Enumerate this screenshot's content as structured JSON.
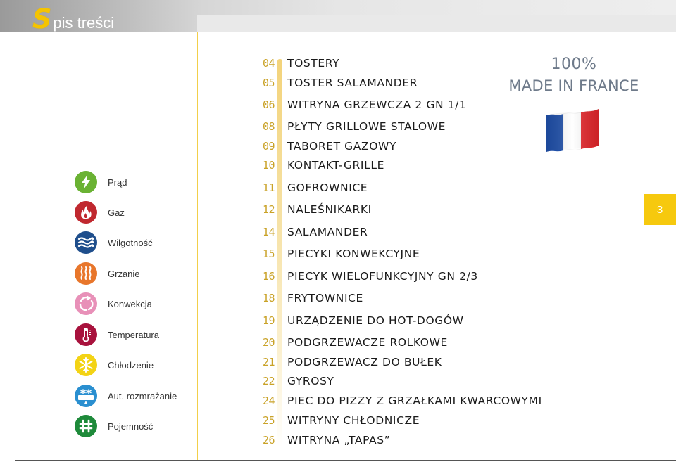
{
  "header": {
    "title_initial": "S",
    "title_rest": "pis treści"
  },
  "legend": [
    {
      "label": "Prąd",
      "icon": "lightning-icon",
      "color": "#6ab233"
    },
    {
      "label": "Gaz",
      "icon": "gas-flame-icon",
      "color": "#c0282f"
    },
    {
      "label": "Wilgotność",
      "icon": "humidity-waves-icon",
      "color": "#1f4e8c"
    },
    {
      "label": "Grzanie",
      "icon": "heating-icon",
      "color": "#e8762b"
    },
    {
      "label": "Konwekcja",
      "icon": "convection-icon",
      "color": "#e890b8"
    },
    {
      "label": "Temperatura",
      "icon": "thermometer-icon",
      "color": "#a8123d"
    },
    {
      "label": "Chłodzenie",
      "icon": "snowflake-icon",
      "color": "#f3d315"
    },
    {
      "label": "Aut. rozmrażanie",
      "icon": "auto-defrost-icon",
      "color": "#2a8fd0"
    },
    {
      "label": "Pojemność",
      "icon": "capacity-grid-icon",
      "color": "#1e8a3a"
    }
  ],
  "toc": [
    {
      "page": "04",
      "title": "TOSTERY"
    },
    {
      "page": "05",
      "title": "TOSTER SALAMANDER"
    },
    {
      "page": "06",
      "title": "WITRYNA GRZEWCZA 2 GN 1/1"
    },
    {
      "page": "08",
      "title": "PŁYTY GRILLOWE STALOWE"
    },
    {
      "page": "09",
      "title": "TABORET GAZOWY"
    },
    {
      "page": "10",
      "title": "KONTAKT-GRILLE"
    },
    {
      "page": "11",
      "title": "GOFROWNICE"
    },
    {
      "page": "12",
      "title": "NALEŚNIKARKI"
    },
    {
      "page": "14",
      "title": "SALAMANDER"
    },
    {
      "page": "15",
      "title": "PIECYKI KONWEKCYJNE"
    },
    {
      "page": "16",
      "title": "PIECYK WIELOFUNKCYJNY GN 2/3"
    },
    {
      "page": "18",
      "title": "FRYTOWNICE"
    },
    {
      "page": "19",
      "title": "URZĄDZENIE DO HOT-DOGÓW"
    },
    {
      "page": "20",
      "title": "PODGRZEWACZE ROLKOWE"
    },
    {
      "page": "21",
      "title": "PODGRZEWACZ DO BUŁEK"
    },
    {
      "page": "22",
      "title": "GYROSY"
    },
    {
      "page": "24",
      "title": "PIEC DO PIZZY Z GRZAŁKAMI KWARCOWYMI"
    },
    {
      "page": "25",
      "title": "WITRYNY CHŁODNICZE"
    },
    {
      "page": "26",
      "title": "WITRYNA „TAPAS”"
    }
  ],
  "badge": {
    "percent": "100%",
    "text": "MADE IN FRANCE",
    "flag_colors": [
      "#1f4fa8",
      "#ffffff",
      "#e3262b"
    ]
  },
  "page_number": "3",
  "colors": {
    "accent_yellow": "#f6c90e",
    "page_number_gold": "#c9a227"
  }
}
